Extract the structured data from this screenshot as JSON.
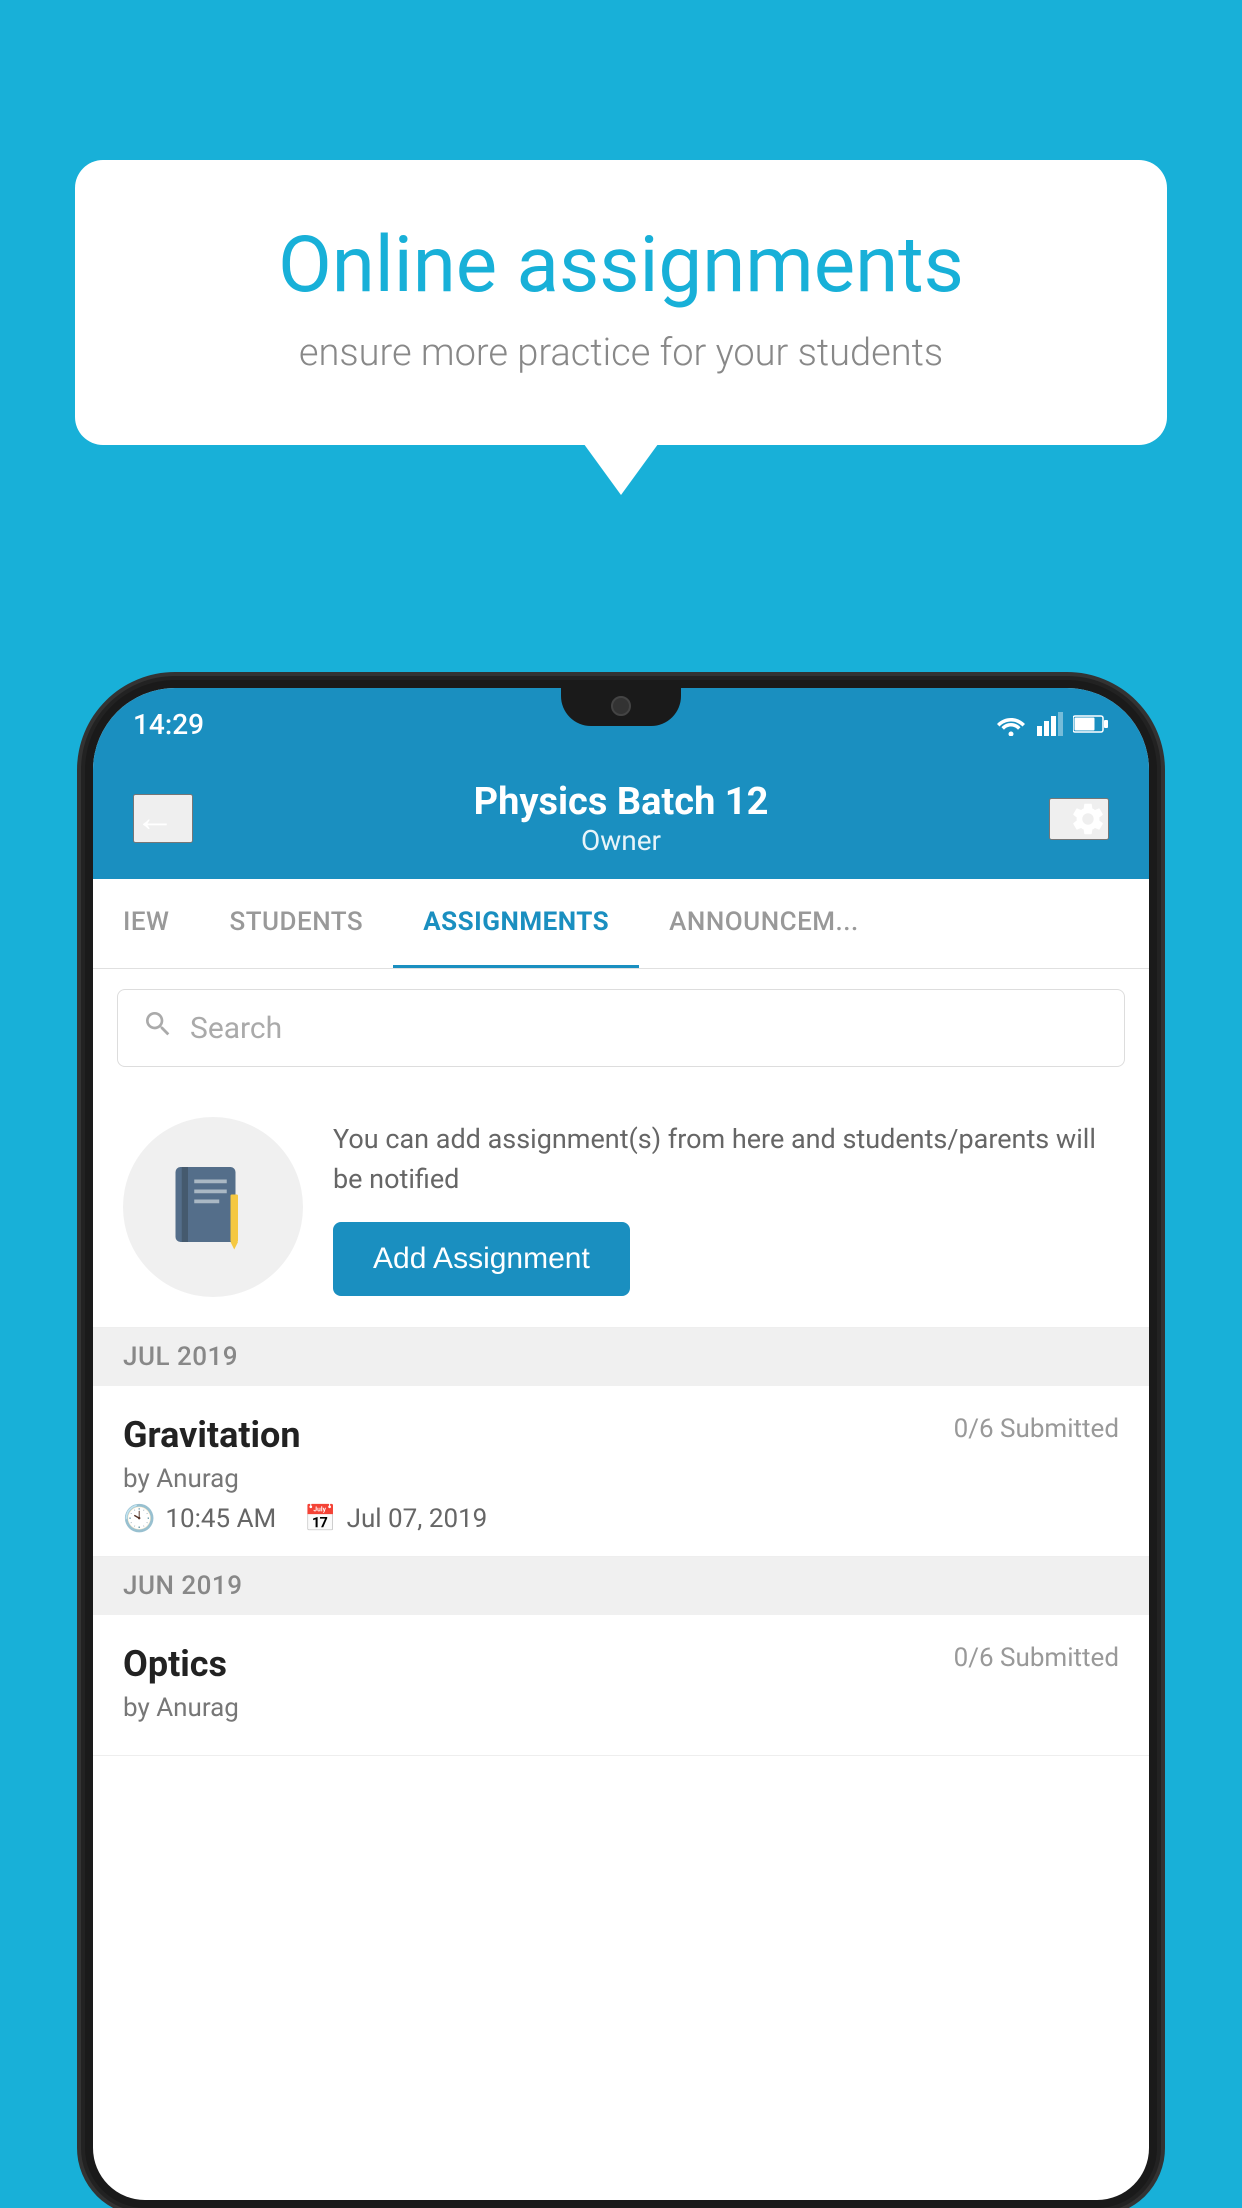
{
  "background_color": "#18b0d8",
  "speech_bubble": {
    "title": "Online assignments",
    "subtitle": "ensure more practice for your students"
  },
  "status_bar": {
    "time": "14:29",
    "wifi_icon": "wifi-icon",
    "signal_icon": "signal-icon",
    "battery_icon": "battery-icon"
  },
  "app_header": {
    "title": "Physics Batch 12",
    "subtitle": "Owner",
    "back_button_label": "←",
    "settings_button_label": "⚙"
  },
  "tabs": [
    {
      "label": "IEW",
      "active": false
    },
    {
      "label": "STUDENTS",
      "active": false
    },
    {
      "label": "ASSIGNMENTS",
      "active": true
    },
    {
      "label": "ANNOUNCEM...",
      "active": false
    }
  ],
  "search": {
    "placeholder": "Search"
  },
  "promo": {
    "icon": "📓",
    "text": "You can add assignment(s) from here and students/parents will be notified",
    "button_label": "Add Assignment"
  },
  "months": [
    {
      "label": "JUL 2019",
      "assignments": [
        {
          "name": "Gravitation",
          "submitted": "0/6 Submitted",
          "by": "by Anurag",
          "time": "10:45 AM",
          "date": "Jul 07, 2019"
        }
      ]
    },
    {
      "label": "JUN 2019",
      "assignments": [
        {
          "name": "Optics",
          "submitted": "0/6 Submitted",
          "by": "by Anurag",
          "time": "",
          "date": ""
        }
      ]
    }
  ]
}
